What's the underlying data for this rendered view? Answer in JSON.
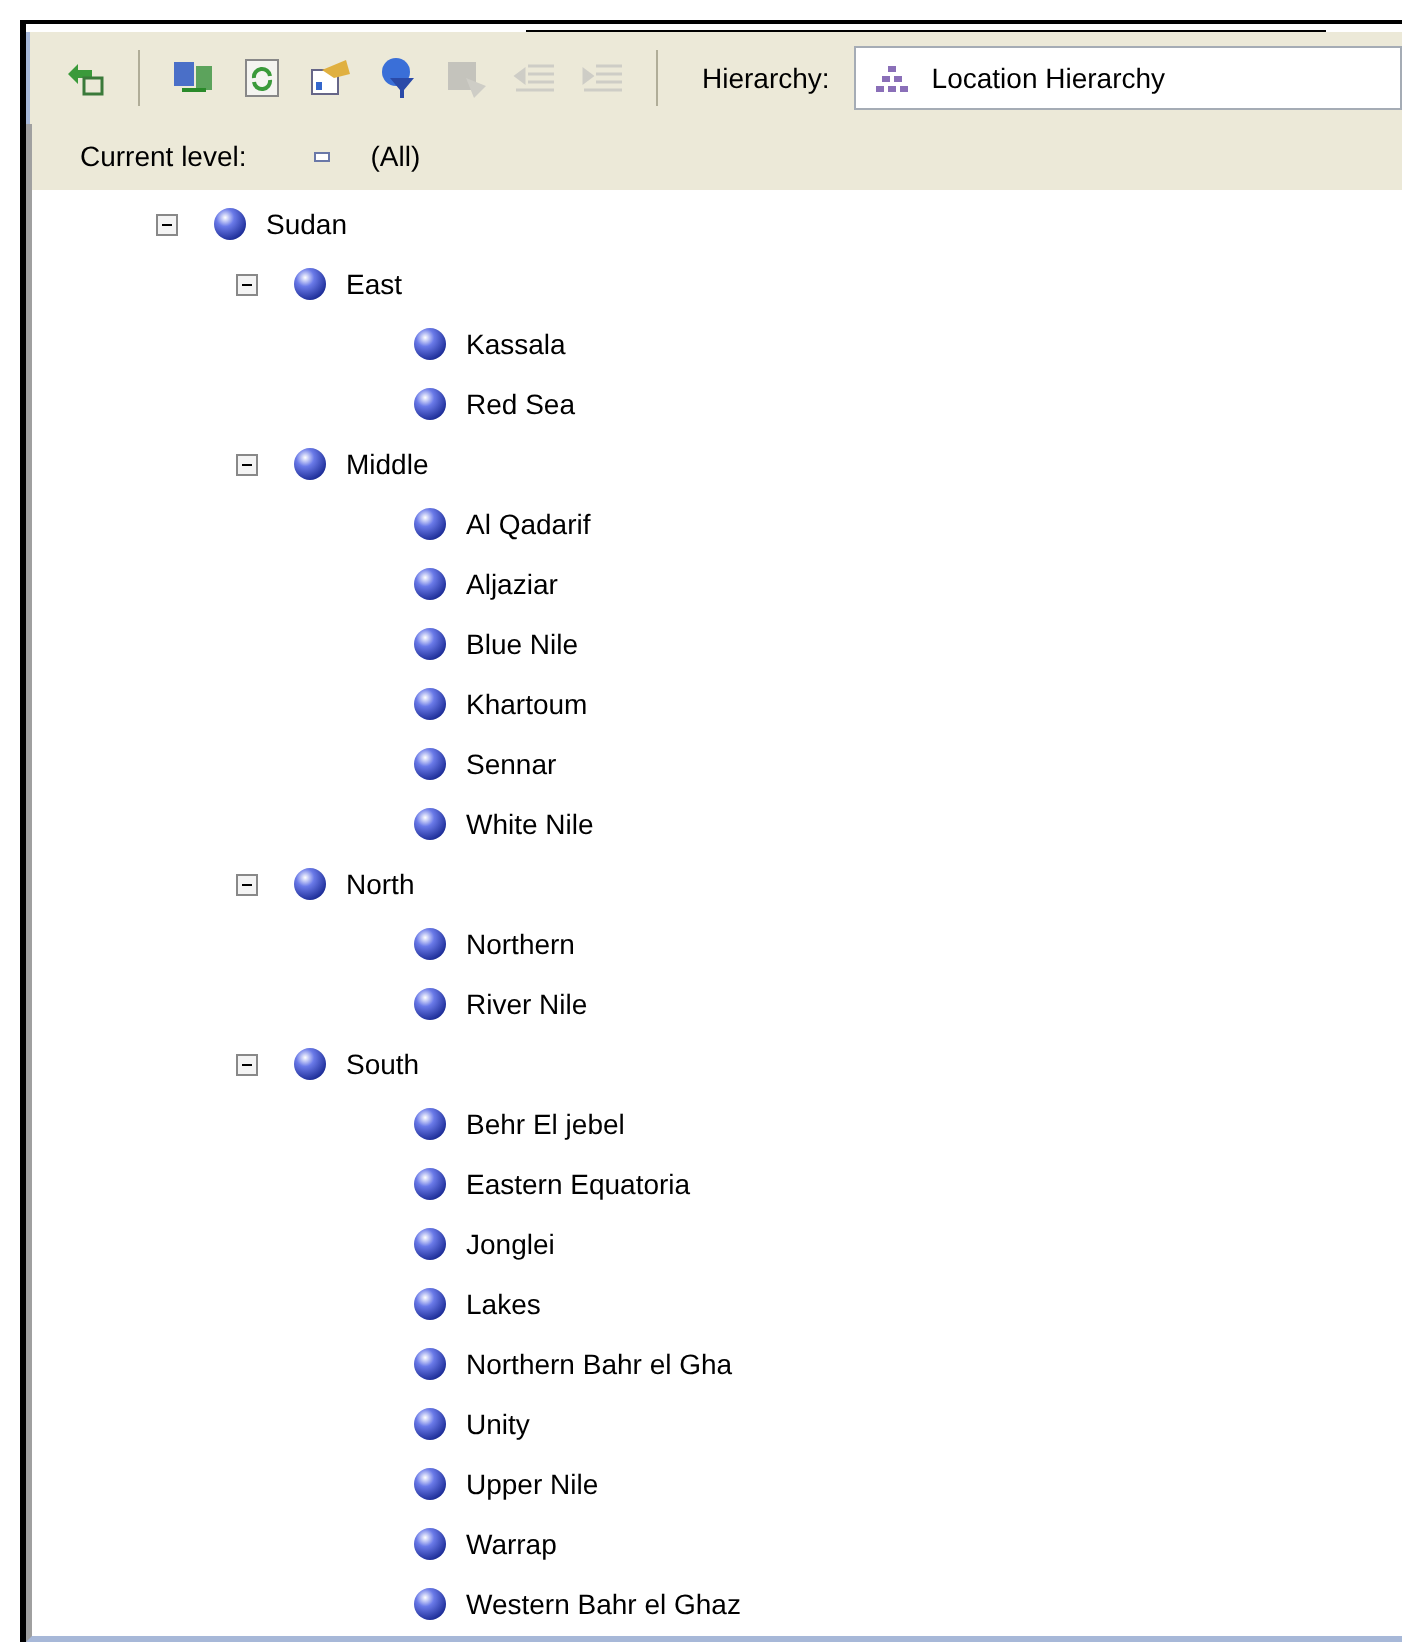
{
  "toolbar": {
    "buttons": [
      {
        "kind": "refresh",
        "disabled": false
      },
      {
        "kind": "separator"
      },
      {
        "kind": "grid",
        "disabled": false
      },
      {
        "kind": "reload",
        "disabled": false
      },
      {
        "kind": "chart",
        "disabled": false
      },
      {
        "kind": "filter",
        "disabled": false
      },
      {
        "kind": "block",
        "disabled": true
      },
      {
        "kind": "outdent",
        "disabled": true
      },
      {
        "kind": "indent",
        "disabled": true
      },
      {
        "kind": "separator"
      }
    ],
    "hierarchy_label": "Hierarchy:",
    "hierarchy_value": "Location Hierarchy"
  },
  "current_level": {
    "label": "Current level:",
    "value": "(All)"
  },
  "tree": [
    {
      "label": "Sudan",
      "expanded": true,
      "children": [
        {
          "label": "East",
          "expanded": true,
          "children": [
            {
              "label": "Kassala"
            },
            {
              "label": "Red Sea"
            }
          ]
        },
        {
          "label": "Middle",
          "expanded": true,
          "children": [
            {
              "label": "Al Qadarif"
            },
            {
              "label": "Aljaziar"
            },
            {
              "label": "Blue Nile"
            },
            {
              "label": "Khartoum"
            },
            {
              "label": "Sennar"
            },
            {
              "label": "White Nile"
            }
          ]
        },
        {
          "label": "North",
          "expanded": true,
          "children": [
            {
              "label": "Northern"
            },
            {
              "label": "River Nile"
            }
          ]
        },
        {
          "label": "South",
          "expanded": true,
          "children": [
            {
              "label": "Behr El jebel"
            },
            {
              "label": "Eastern Equatoria"
            },
            {
              "label": "Jonglei"
            },
            {
              "label": "Lakes"
            },
            {
              "label": "Northern Bahr el Gha"
            },
            {
              "label": "Unity"
            },
            {
              "label": "Upper Nile"
            },
            {
              "label": "Warrap"
            },
            {
              "label": "Western Bahr el Ghaz"
            }
          ]
        }
      ]
    }
  ]
}
